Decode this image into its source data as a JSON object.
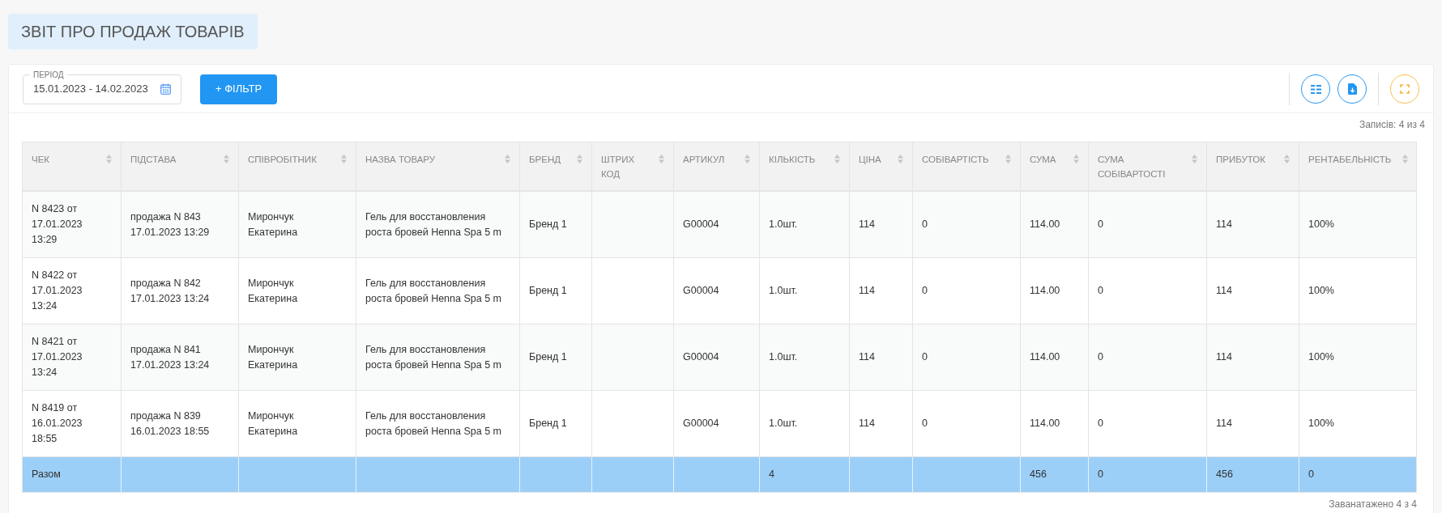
{
  "page_title": "ЗВІТ ПРО ПРОДАЖ ТОВАРІВ",
  "period": {
    "label": "ПЕРІОД",
    "value": "15.01.2023 - 14.02.2023"
  },
  "filter_button": "+ ФІЛЬТР",
  "records_count": "Записів: 4 из 4",
  "table": {
    "columns": [
      "ЧЕК",
      "ПІДСТАВА",
      "СПІВРОБІТНИК",
      "НАЗВА ТОВАРУ",
      "БРЕНД",
      "ШТРИХ КОД",
      "АРТИКУЛ",
      "КІЛЬКІСТЬ",
      "ЦІНА",
      "СОБІВАРТІСТЬ",
      "СУМА",
      "СУМА СОБІВАРТОСТІ",
      "ПРИБУТОК",
      "РЕНТАБЕЛЬНІСТЬ"
    ],
    "rows": [
      [
        "N 8423 от 17.01.2023 13:29",
        "продажа N 843 17.01.2023 13:29",
        "Мирончук Екатерина",
        "Гель для восстановления роста бровей Henna Spa 5 m",
        "Бренд 1",
        null,
        "G00004",
        "1.0шт.",
        "114",
        "0",
        "114.00",
        "0",
        "114",
        "100%"
      ],
      [
        "N 8422 от 17.01.2023 13:24",
        "продажа N 842 17.01.2023 13:24",
        "Мирончук Екатерина",
        "Гель для восстановления роста бровей Henna Spa 5 m",
        "Бренд 1",
        null,
        "G00004",
        "1.0шт.",
        "114",
        "0",
        "114.00",
        "0",
        "114",
        "100%"
      ],
      [
        "N 8421 от 17.01.2023 13:24",
        "продажа N 841 17.01.2023 13:24",
        "Мирончук Екатерина",
        "Гель для восстановления роста бровей Henna Spa 5 m",
        "Бренд 1",
        null,
        "G00004",
        "1.0шт.",
        "114",
        "0",
        "114.00",
        "0",
        "114",
        "100%"
      ],
      [
        "N 8419 от 16.01.2023 18:55",
        "продажа N 839 16.01.2023 18:55",
        "Мирончук Екатерина",
        "Гель для восстановления роста бровей Henna Spa 5 m",
        "Бренд 1",
        null,
        "G00004",
        "1.0шт.",
        "114",
        "0",
        "114.00",
        "0",
        "114",
        "100%"
      ]
    ],
    "total_row": {
      "label": "Разом",
      "quantity": "4",
      "sum": "456",
      "cost_sum": "0",
      "profit": "456",
      "profitability": "0"
    }
  },
  "loaded_count": "Заванатажено 4 з 4"
}
